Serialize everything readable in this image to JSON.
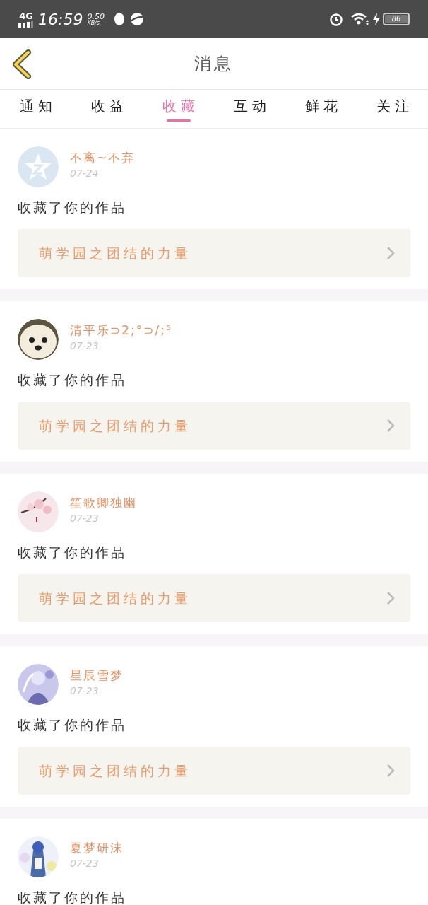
{
  "status_bar": {
    "network": "4G",
    "time": "16:59",
    "speed": "0.50",
    "speed_unit": "KB/s",
    "battery": "86"
  },
  "header": {
    "title": "消息"
  },
  "tabs": [
    {
      "label": "通知",
      "selected": false
    },
    {
      "label": "收益",
      "selected": false
    },
    {
      "label": "收藏",
      "selected": true
    },
    {
      "label": "互动",
      "selected": false
    },
    {
      "label": "鲜花",
      "selected": false
    },
    {
      "label": "关注",
      "selected": false
    }
  ],
  "messages": [
    {
      "avatar": {
        "kind": "icon"
      },
      "user": "不离~不弃",
      "date": "07-24",
      "text": "收藏了你的作品",
      "work": "萌学园之团结的力量"
    },
    {
      "user": "清平乐⊃2;°⊃/;⁵",
      "date": "07-23",
      "text": "收藏了你的作品",
      "work": "萌学园之团结的力量"
    },
    {
      "user": "笙歌卿独幽",
      "date": "07-23",
      "text": "收藏了你的作品",
      "work": "萌学园之团结的力量"
    },
    {
      "user": "星辰雪梦",
      "date": "07-23",
      "text": "收藏了你的作品",
      "work": "萌学园之团结的力量"
    },
    {
      "user": "夏梦研沫",
      "date": "07-23",
      "text": "收藏了你的作品"
    }
  ]
}
